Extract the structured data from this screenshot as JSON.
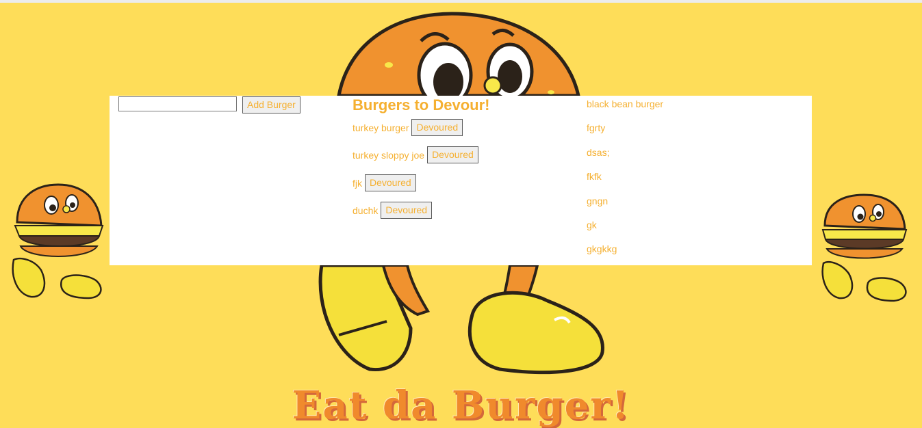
{
  "form": {
    "input_value": "",
    "add_button_label": "Add Burger"
  },
  "undevoured": {
    "heading": "Burgers to Devour!",
    "items": [
      {
        "name": "turkey burger",
        "button_label": "Devoured"
      },
      {
        "name": "turkey sloppy joe",
        "button_label": "Devoured"
      },
      {
        "name": "fjk",
        "button_label": "Devoured"
      },
      {
        "name": "duchk",
        "button_label": "Devoured"
      }
    ]
  },
  "devoured": {
    "items": [
      "black bean burger",
      "fgrty",
      "dsas;",
      "fkfk",
      "gngn",
      "gk",
      "gkgkkg"
    ]
  },
  "branding": {
    "logo_text": "Eat da Burger!"
  },
  "colors": {
    "background": "#fedd59",
    "text_accent": "#f5b031",
    "bun": "#f0922f",
    "shoe": "#f5e03a",
    "logo": "#f08a2c"
  }
}
